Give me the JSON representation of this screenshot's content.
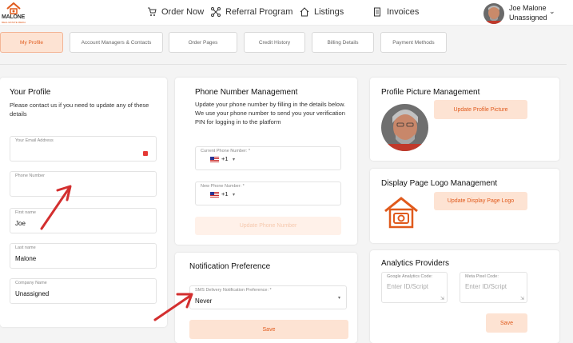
{
  "brand": {
    "logo_text": "MALONE",
    "logo_sub": "REAL ESTATE MEDIA",
    "accent": "#e05a1c"
  },
  "nav": {
    "items": [
      {
        "label": "Order Now",
        "icon": "cart-icon"
      },
      {
        "label": "Referral Program",
        "icon": "network-icon"
      },
      {
        "label": "Listings",
        "icon": "home-icon"
      },
      {
        "label": "Invoices",
        "icon": "document-icon"
      }
    ],
    "user": {
      "name": "Joe Malone",
      "status": "Unassigned"
    }
  },
  "tabs": [
    "My Profile",
    "Account Managers & Contacts",
    "Order Pages",
    "Credit History",
    "Billing Details",
    "Payment Methods"
  ],
  "profile": {
    "title": "Your Profile",
    "description": "Please contact us if you need to update any of these details",
    "email_label": "Your Email Address",
    "phone_label": "Phone Number",
    "first_label": "First name",
    "first_value": "Joe",
    "last_label": "Last name",
    "last_value": "Malone",
    "company_label": "Company Name",
    "company_value": "Unassigned"
  },
  "phone_mgmt": {
    "title": "Phone Number Management",
    "description": "Update your phone number by filling in the details below. We use your phone number to send you your verification PIN for logging in to the platform",
    "current_label": "Current Phone Number: *",
    "new_label": "New Phone Number: *",
    "country_code": "+1",
    "button": "Update Phone Number"
  },
  "notification": {
    "title": "Notification Preference",
    "label": "SMS Delivery Notification Preference: *",
    "value": "Never",
    "button": "Save"
  },
  "picture": {
    "title": "Profile Picture Management",
    "button": "Update Profile Picture"
  },
  "logo_mgmt": {
    "title": "Display Page Logo Management",
    "button": "Update Display Page Logo"
  },
  "analytics": {
    "title": "Analytics Providers",
    "ga_label": "Google Analytics Code:",
    "ga_placeholder": "Enter ID/Script",
    "pixel_label": "Meta Pixel Code:",
    "pixel_placeholder": "Enter ID/Script",
    "button": "Save"
  }
}
